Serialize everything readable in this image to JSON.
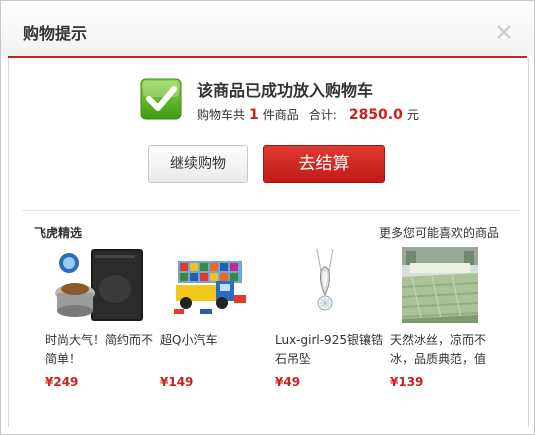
{
  "dialog": {
    "title": "购物提示",
    "close_icon": "close-icon"
  },
  "message": {
    "title": "该商品已成功放入购物车",
    "cart_prefix": "购物车共",
    "count": "1",
    "cart_suffix": "件商品",
    "total_label": "合计:",
    "total_value": "2850.0",
    "currency": "元",
    "icon": "checkmark-icon"
  },
  "buttons": {
    "continue": "继续购物",
    "checkout": "去结算"
  },
  "recommend": {
    "left_title": "飞虎精选",
    "right_title": "更多您可能喜欢的商品",
    "items": [
      {
        "name": "时尚大气！简约而不简单！",
        "price": "¥249",
        "image": "induction-cooker-image"
      },
      {
        "name": "超Q小汽车",
        "price": "¥149",
        "image": "toy-car-image"
      },
      {
        "name": "Lux-girl-925银镶锆石吊坠",
        "price": "¥49",
        "image": "pendant-image"
      },
      {
        "name": "天然冰丝，凉而不冰，品质典范，值",
        "price": "¥139",
        "image": "bedding-image"
      }
    ]
  },
  "colors": {
    "accent": "#c8221f",
    "check_green": "#5bb318"
  }
}
